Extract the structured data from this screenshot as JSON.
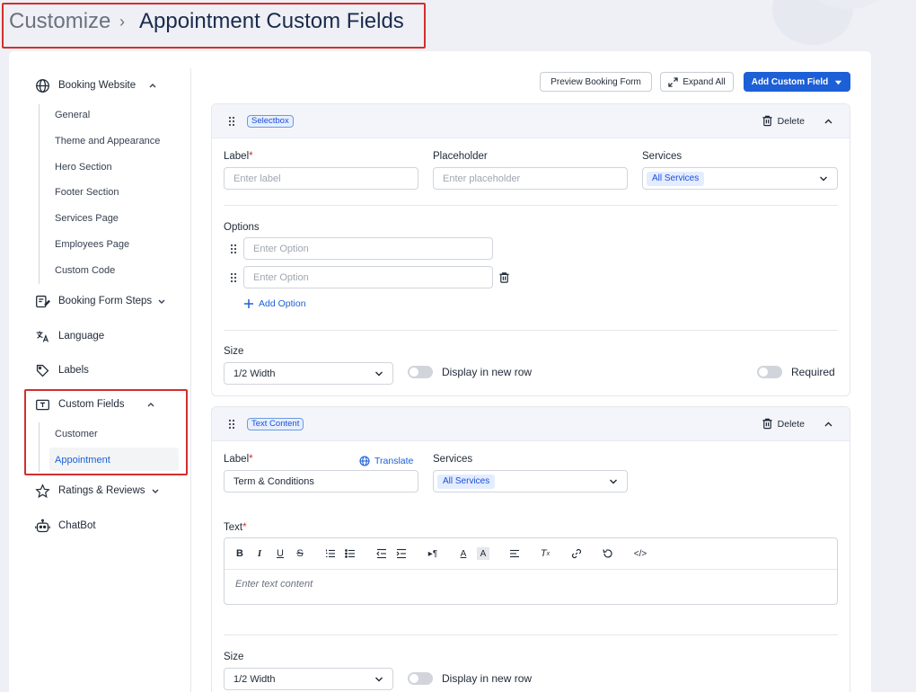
{
  "breadcrumb": {
    "root": "Customize",
    "separator": "›",
    "current": "Appointment Custom Fields"
  },
  "sidebar": {
    "booking_website": {
      "label": "Booking Website",
      "items": [
        "General",
        "Theme and Appearance",
        "Hero Section",
        "Footer Section",
        "Services Page",
        "Employees Page",
        "Custom Code"
      ]
    },
    "booking_form_steps": "Booking Form Steps",
    "language": "Language",
    "labels": "Labels",
    "custom_fields": {
      "label": "Custom Fields",
      "items": [
        "Customer",
        "Appointment"
      ]
    },
    "ratings_reviews": "Ratings & Reviews",
    "chatbot": "ChatBot"
  },
  "toolbar": {
    "preview": "Preview Booking Form",
    "expand": "Expand All",
    "add": "Add Custom Field"
  },
  "field1": {
    "type": "Selectbox",
    "delete": "Delete",
    "label_label": "Label",
    "label_placeholder": "Enter label",
    "placeholder_label": "Placeholder",
    "placeholder_placeholder": "Enter placeholder",
    "services_label": "Services",
    "services_value": "All Services",
    "options_label": "Options",
    "option_placeholder": "Enter Option",
    "add_option": "Add Option",
    "size_label": "Size",
    "size_value": "1/2 Width",
    "new_row": "Display in new row",
    "required": "Required"
  },
  "field2": {
    "type": "Text Content",
    "delete": "Delete",
    "label_label": "Label",
    "translate": "Translate",
    "label_value": "Term & Conditions",
    "services_label": "Services",
    "services_value": "All Services",
    "text_label": "Text",
    "editor_placeholder": "Enter text content",
    "size_label": "Size",
    "size_value": "1/2 Width",
    "new_row": "Display in new row"
  },
  "colors": {
    "accent": "#1d5fd6",
    "highlight_box": "#d32f2f"
  }
}
